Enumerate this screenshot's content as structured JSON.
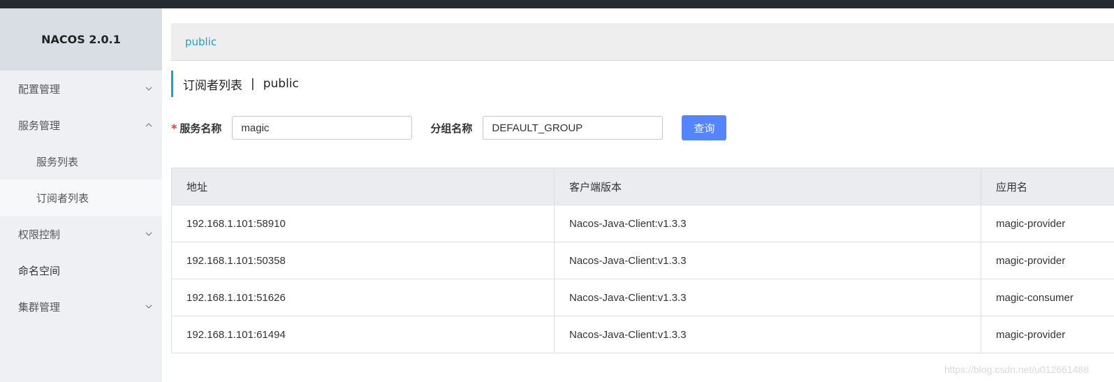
{
  "app": {
    "brand": "NACOS 2.0.1"
  },
  "sidebar": {
    "items": [
      {
        "label": "配置管理",
        "chevron": "down"
      },
      {
        "label": "服务管理",
        "chevron": "up"
      },
      {
        "label": "服务列表"
      },
      {
        "label": "订阅者列表",
        "active": true
      },
      {
        "label": "权限控制",
        "chevron": "down"
      },
      {
        "label": "命名空间"
      },
      {
        "label": "集群管理",
        "chevron": "down"
      }
    ]
  },
  "breadcrumb": {
    "namespace": "public"
  },
  "page": {
    "title": "订阅者列表",
    "separator": "|",
    "namespace": "public"
  },
  "filters": {
    "service_label": "服务名称",
    "service_value": "magic",
    "group_label": "分组名称",
    "group_value": "DEFAULT_GROUP",
    "query_label": "查询",
    "required_mark": "*"
  },
  "table": {
    "headers": [
      "地址",
      "客户端版本",
      "应用名"
    ],
    "rows": [
      [
        "192.168.1.101:58910",
        "Nacos-Java-Client:v1.3.3",
        "magic-provider"
      ],
      [
        "192.168.1.101:50358",
        "Nacos-Java-Client:v1.3.3",
        "magic-provider"
      ],
      [
        "192.168.1.101:51626",
        "Nacos-Java-Client:v1.3.3",
        "magic-consumer"
      ],
      [
        "192.168.1.101:61494",
        "Nacos-Java-Client:v1.3.3",
        "magic-provider"
      ]
    ]
  },
  "watermark": "https://blog.csdn.net/u012661488",
  "colors": {
    "accent": "#1ba3c6",
    "primary_button": "#5584ff",
    "required": "#e23c39",
    "topbar": "#262b31"
  },
  "icons": {
    "chevron_down": "chevron-down-icon",
    "chevron_up": "chevron-up-icon"
  }
}
